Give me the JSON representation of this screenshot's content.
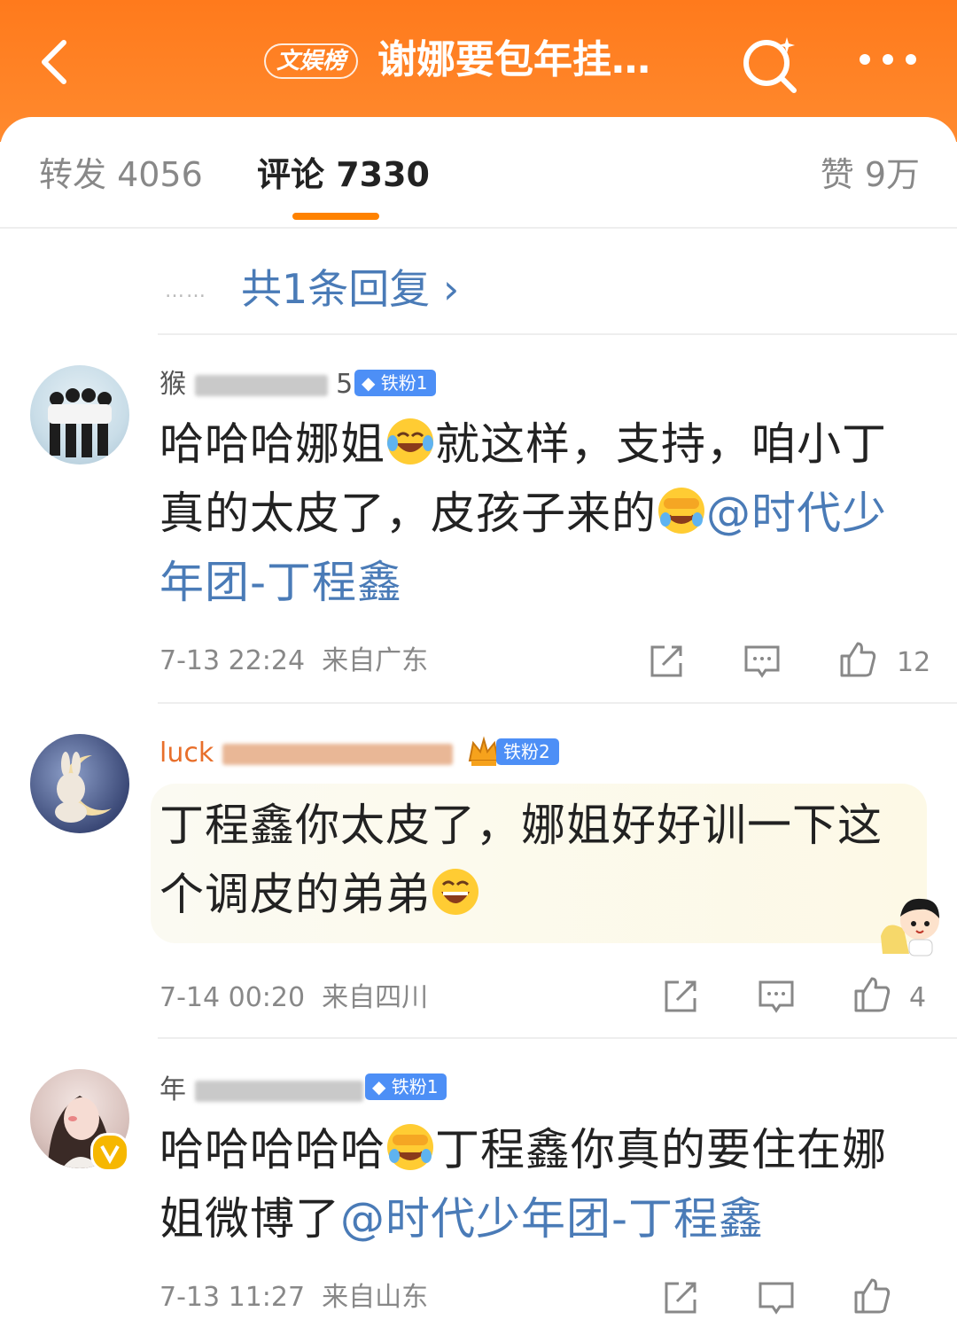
{
  "header": {
    "hot_badge": "文娱榜",
    "topic_title": "谢娜要包年挂…"
  },
  "tabs": {
    "repost": "转发 4056",
    "comments": "评论 7330",
    "likes": "赞 9万"
  },
  "reply_thread": {
    "dots": "……",
    "link": "共1条回复 ›"
  },
  "comments": [
    {
      "username_visible_start": "猴",
      "username_visible_end": "5",
      "fan_badge": "铁粉1",
      "text_before": "哈哈哈娜姐",
      "emoji_1": "laughing-tears",
      "text_middle": "就这样，支持，咱小丁真的太皮了，皮孩子来的",
      "emoji_2": "face-palm-laugh",
      "mention": "@时代少年团-丁程鑫",
      "time": "7-13 22:24",
      "location": "来自广东",
      "likes": "12"
    },
    {
      "username_visible_start": "luck",
      "fan_badge": "铁粉2",
      "text_before": "丁程鑫你太皮了，娜姐好好训一下这个调皮的弟弟",
      "emoji_1": "big-grin",
      "time": "7-14 00:20",
      "location": "来自四川",
      "likes": "4"
    },
    {
      "username_visible_start": "年",
      "fan_badge": "铁粉1",
      "text_before": "哈哈哈哈哈",
      "emoji_1": "face-palm-laugh",
      "text_middle": "丁程鑫你真的要住在娜姐微博了",
      "mention": "@时代少年团-丁程鑫",
      "time": "7-13 11:27",
      "location": "来自山东"
    }
  ],
  "colors": {
    "header_orange": "#ff7a1c",
    "tab_indicator": "#ff8200",
    "mention_blue": "#4a7bb7",
    "fan_badge_blue": "#4d8ff6"
  }
}
